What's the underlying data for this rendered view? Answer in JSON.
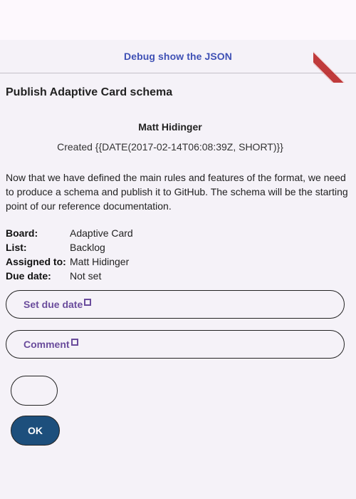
{
  "header": {
    "debug_link": "Debug show the JSON"
  },
  "card": {
    "title": "Publish Adaptive Card schema",
    "author": "Matt Hidinger",
    "created": "Created {{DATE(2017-02-14T06:08:39Z, SHORT)}}",
    "description": "Now that we have defined the main rules and features of the format, we need to produce a schema and publish it to GitHub. The schema will be the starting point of our reference documentation.",
    "facts": [
      {
        "title": "Board:",
        "value": "Adaptive Card"
      },
      {
        "title": "List:",
        "value": "Backlog"
      },
      {
        "title": "Assigned to:",
        "value": "Matt Hidinger"
      },
      {
        "title": "Due date:",
        "value": "Not set"
      }
    ],
    "actions": {
      "set_due_date": "Set due date",
      "comment": "Comment",
      "empty": "",
      "ok": "OK"
    }
  },
  "colors": {
    "accent": "#6a4c9c",
    "link": "#3f51b5",
    "ok_button": "#1d4f7c",
    "background": "#f5f2f8",
    "debug_ribbon": "#b71c1c"
  },
  "icons": {
    "action_indicator": "square-outline-icon",
    "debug_banner": "debug-ribbon-icon"
  }
}
